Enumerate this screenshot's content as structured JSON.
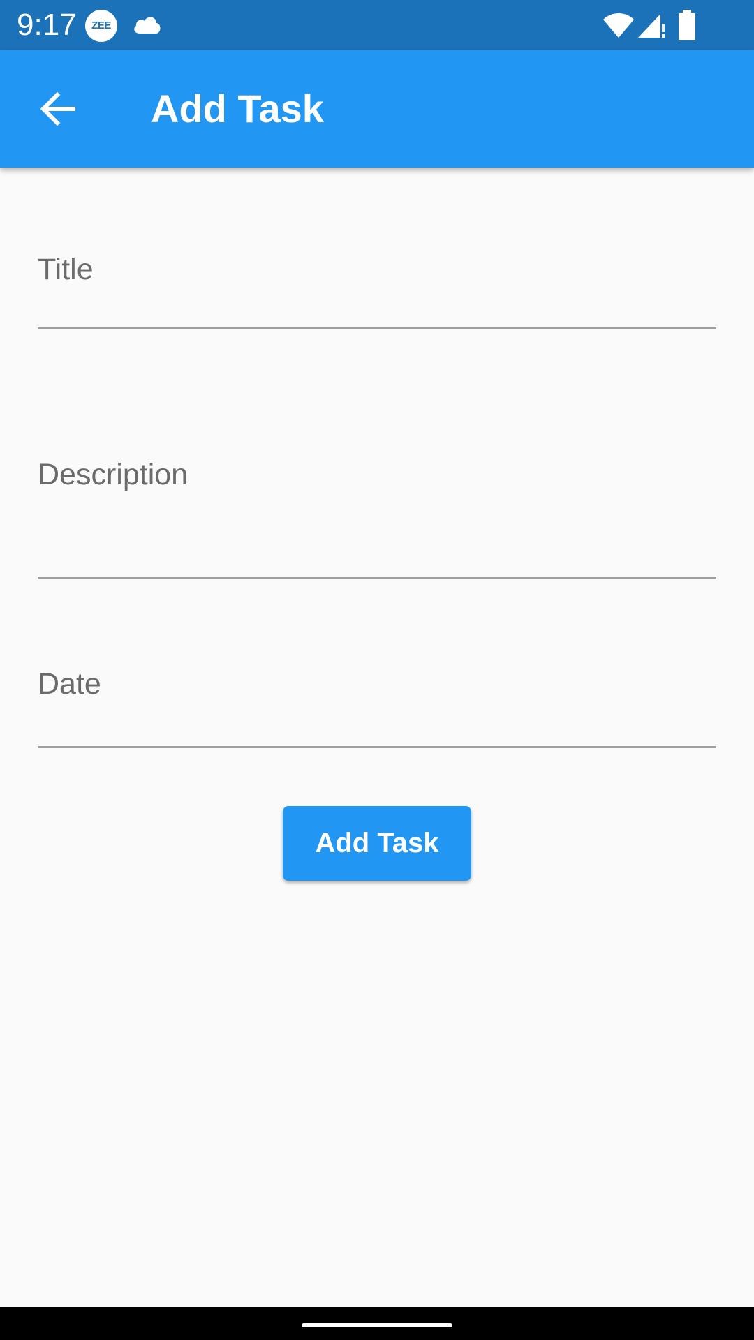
{
  "status_bar": {
    "time": "9:17",
    "badge_text": "ZEE",
    "icons": [
      "zee-app-icon",
      "cloud-icon",
      "wifi-icon",
      "signal-icon",
      "battery-icon"
    ]
  },
  "app_bar": {
    "title": "Add Task",
    "back_icon": "arrow-back-icon",
    "color": "#2196f3"
  },
  "form": {
    "title_label": "Title",
    "description_label": "Description",
    "date_label": "Date",
    "submit_label": "Add Task"
  },
  "colors": {
    "status_bar": "#1b72b9",
    "accent": "#2196f3",
    "background": "#fafafa",
    "label": "#6b6b6b",
    "underline": "#9e9e9e"
  }
}
